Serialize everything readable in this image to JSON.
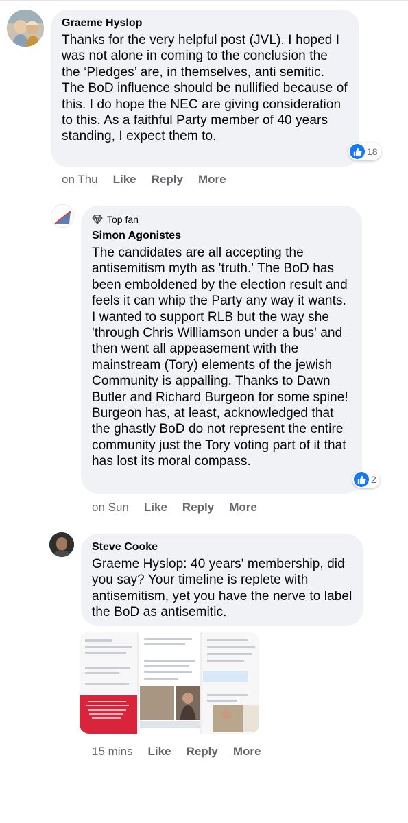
{
  "comments": [
    {
      "author": "Graeme Hyslop",
      "text": "Thanks for the very helpful post (JVL). I hoped I was not alone in coming to the conclusion the the ‘Pledges’ are, in themselves, anti semitic. The BoD influence should be nullified because of this. I do hope the NEC are giving consideration to this. As a faithful Party member of 40 years standing, I expect them to.",
      "time": "on Thu",
      "like": "Like",
      "reply": "Reply",
      "more": "More",
      "reactions": "18"
    },
    {
      "badge": "Top fan",
      "author": "Simon Agonistes",
      "text": "The candidates are all accepting the antisemitism myth as 'truth.' The BoD has been emboldened by the election result and feels it can whip the Party any way it wants. I wanted to support RLB but the way she 'through Chris Williamson under a bus' and then went all appeasement with the mainstream (Tory) elements of the jewish Community is appalling. Thanks to Dawn Butler and Richard Burgeon for some spine! Burgeon has, at least, acknowledged that the ghastly BoD do not represent the entire community just the Tory voting part of it that has lost its moral compass.",
      "time": "on Sun",
      "like": "Like",
      "reply": "Reply",
      "more": "More",
      "reactions": "2"
    },
    {
      "author": "Steve Cooke",
      "text": "Graeme Hyslop: 40 years' membership, did you say? Your timeline is replete with antisemitism, yet you have the nerve to label the BoD as antisemitic.",
      "time": "15 mins",
      "like": "Like",
      "reply": "Reply",
      "more": "More"
    }
  ],
  "icons": {
    "like": "thumbs-up-icon",
    "badge": "diamond-icon"
  },
  "colors": {
    "bubble": "#f0f2f5",
    "meta": "#65676b",
    "like": "#1877f2",
    "thumb_red": "#d9253b"
  }
}
